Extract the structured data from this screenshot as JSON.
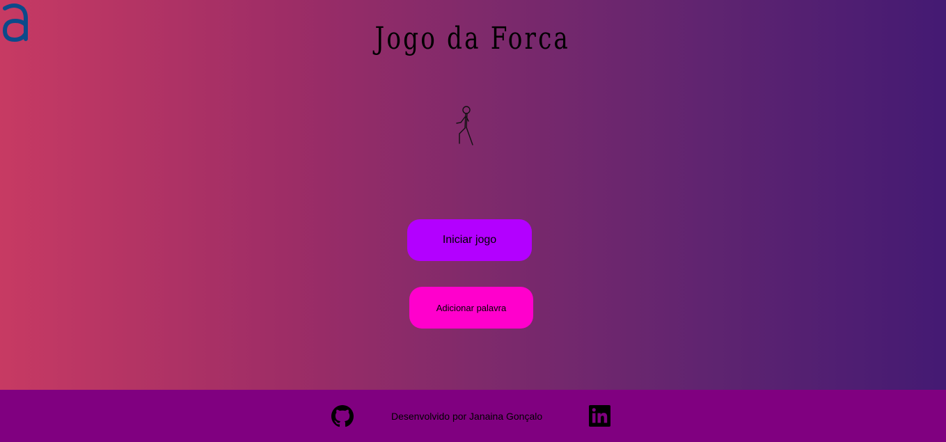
{
  "header": {
    "title": "Jogo da Forca",
    "logo_icon": "alura-a-logo-icon"
  },
  "game": {
    "figure_icon": "stick-figure-icon"
  },
  "buttons": {
    "start_label": "Iniciar jogo",
    "add_word_label": "Adicionar palavra"
  },
  "footer": {
    "credit": "Desenvolvido por Janaina Gonçalo",
    "github_icon": "github-icon",
    "linkedin_icon": "linkedin-icon"
  },
  "colors": {
    "gradient_left": "#c73a63",
    "gradient_right": "#441a73",
    "start_button": "#b300ff",
    "add_button": "#ff00cc",
    "footer": "#800080",
    "logo": "#0c4a8a"
  }
}
